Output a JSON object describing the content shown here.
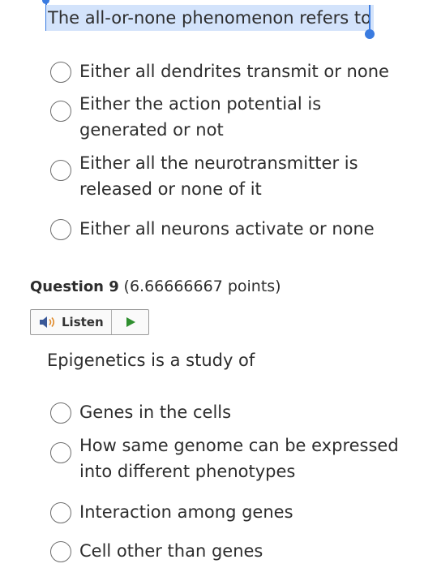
{
  "question8": {
    "text": "The all-or-none phenomenon refers to",
    "options": [
      {
        "label": "Either all dendrites transmit or none"
      },
      {
        "label": "Either the action potential is generated or not"
      },
      {
        "label": "Either all the neurotransmitter is released or none of it"
      },
      {
        "label": "Either all neurons activate or none"
      }
    ]
  },
  "question9": {
    "number_label": "Question 9",
    "points_label": "(6.66666667 points)",
    "listen_label": "Listen",
    "text": "Epigenetics is a study of",
    "options": [
      {
        "label": "Genes in the cells"
      },
      {
        "label": "How same genome can be expressed into different phenotypes"
      },
      {
        "label": "Interaction among genes"
      },
      {
        "label": "Cell other than genes"
      }
    ]
  },
  "colors": {
    "selection_highlight": "#d3e3fb",
    "selection_handle": "#3a7be0",
    "play_icon": "#2f8f2f",
    "speaker_icon": "#3b5998"
  },
  "icons": {
    "speaker": "speaker-icon",
    "play": "play-icon",
    "radio": "radio-button"
  }
}
